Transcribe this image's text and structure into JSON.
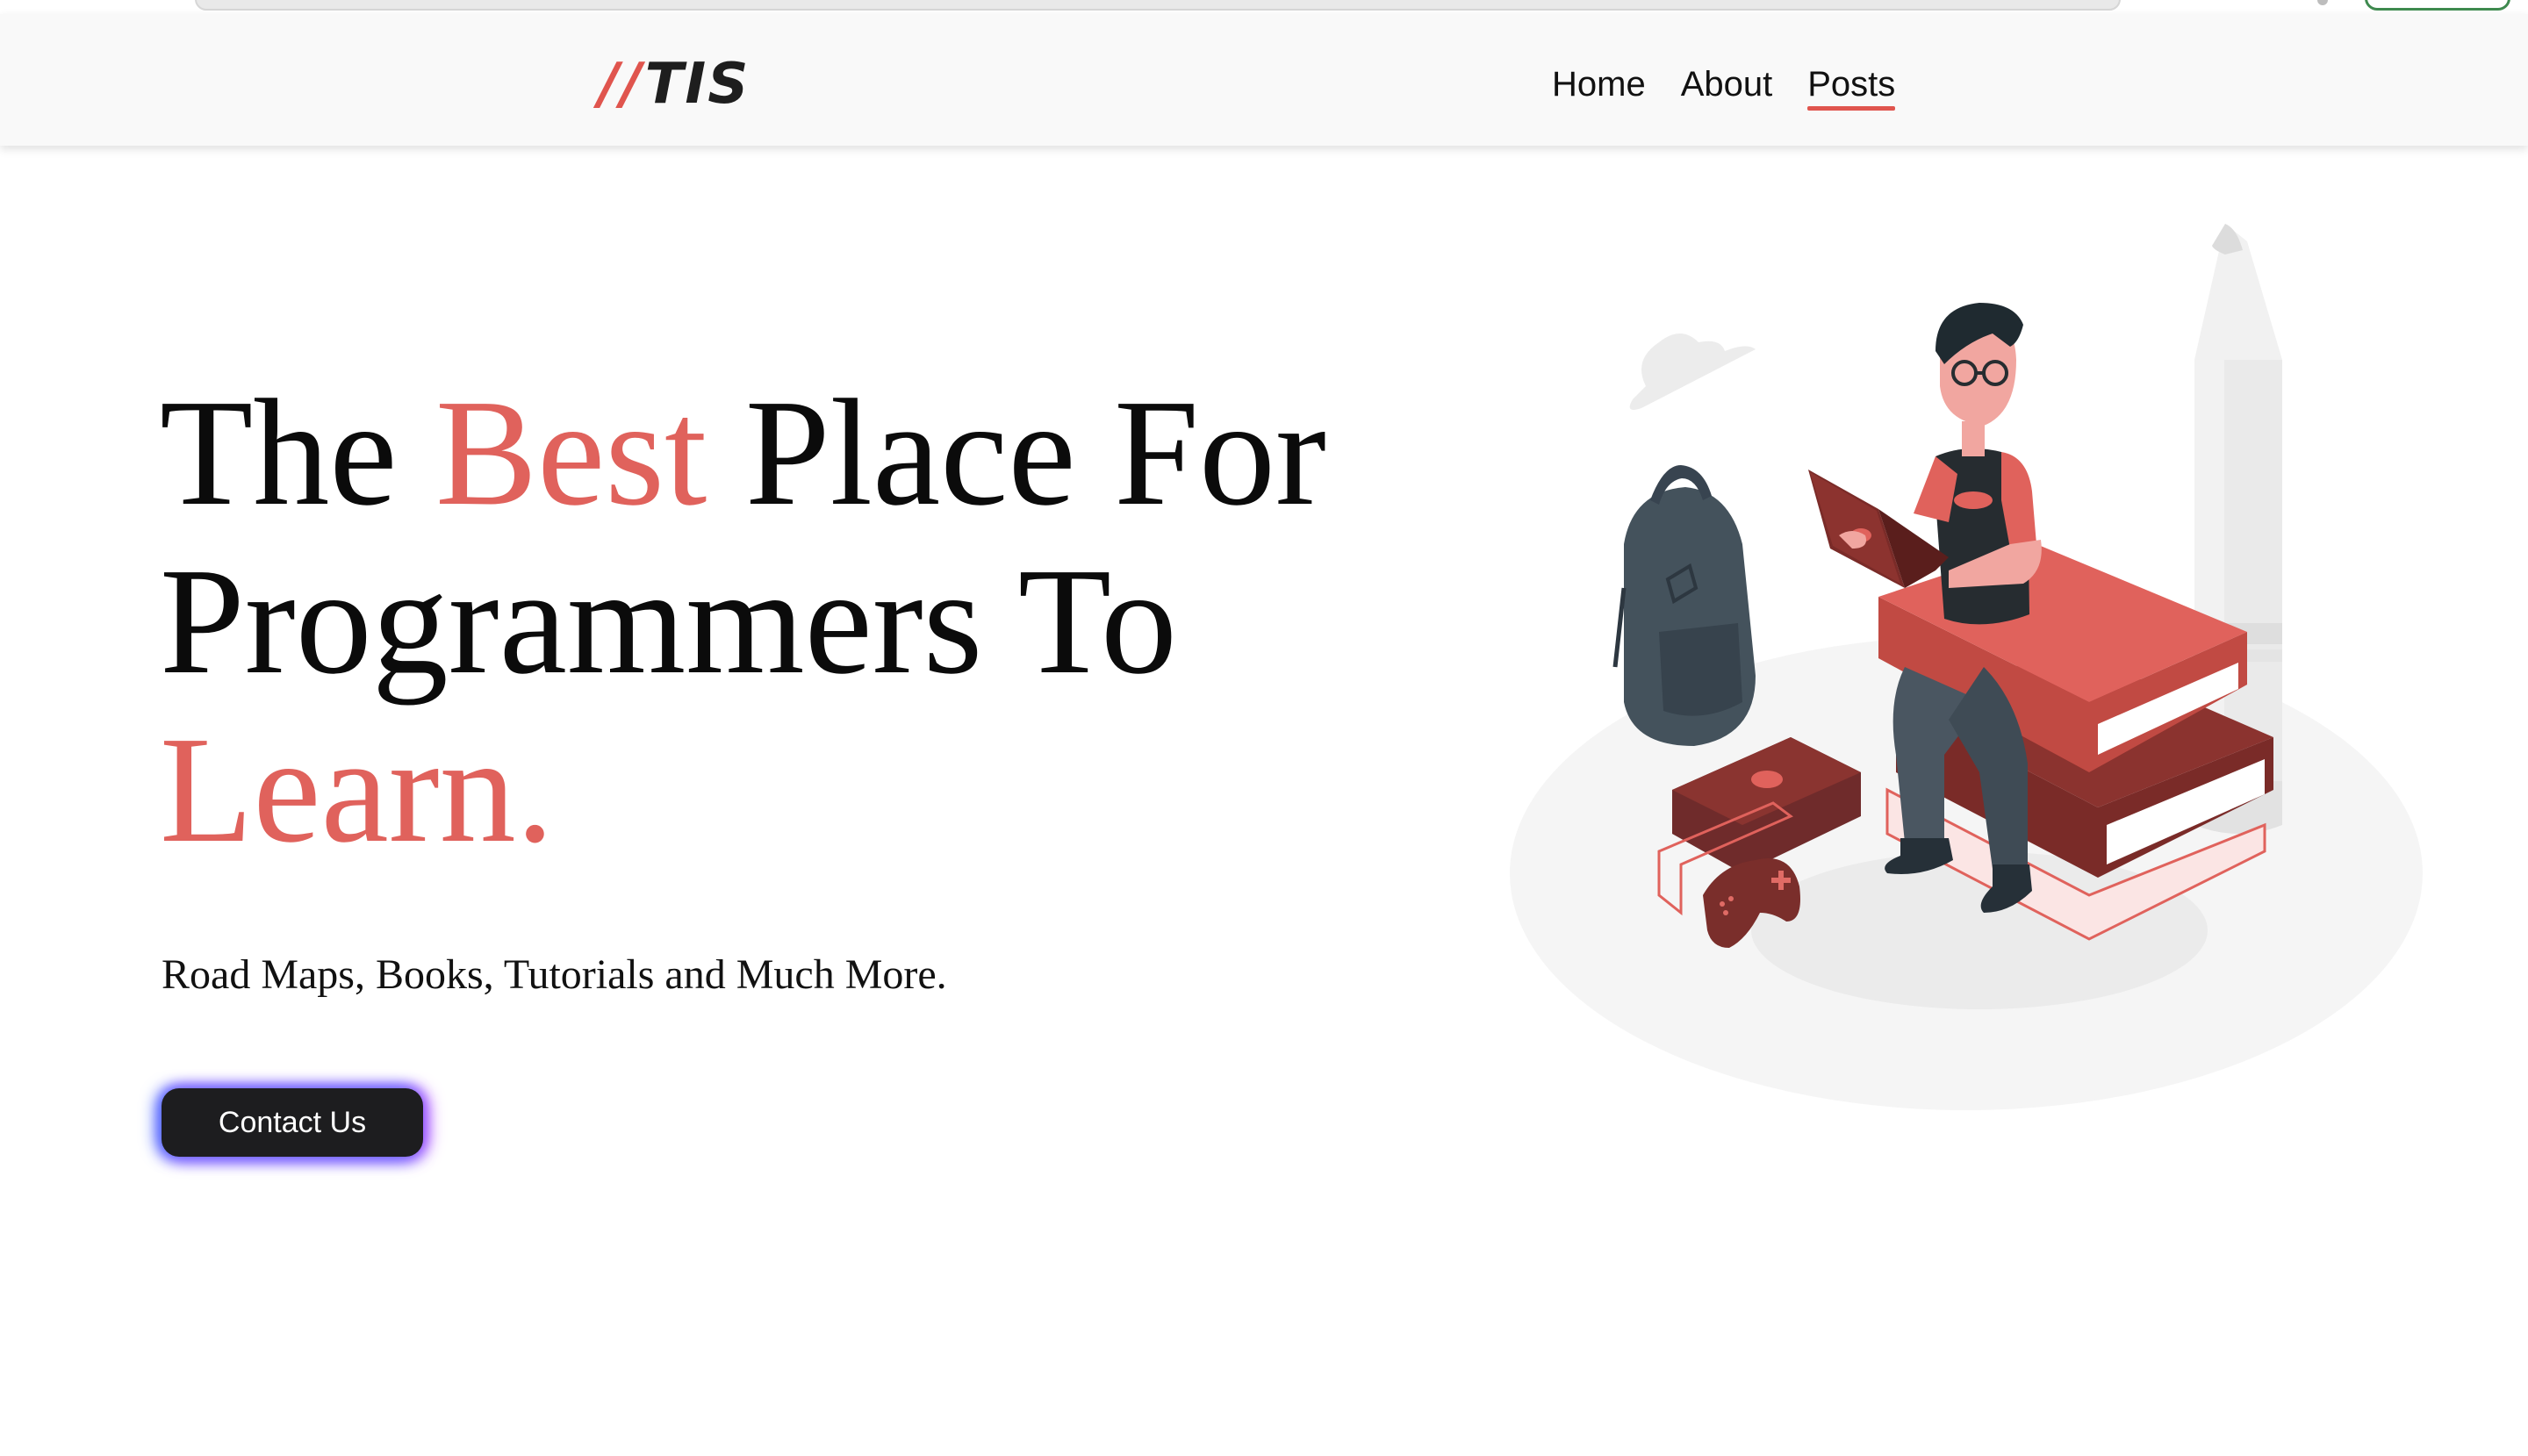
{
  "nav": {
    "logo_slashes": "//",
    "logo_text": "TIS",
    "links": [
      {
        "label": "Home",
        "active": false
      },
      {
        "label": "About",
        "active": false
      },
      {
        "label": "Posts",
        "active": true
      }
    ]
  },
  "hero": {
    "title_part1": "The ",
    "title_accent1": "Best",
    "title_part2": " Place For Programmers To ",
    "title_accent2": "Learn.",
    "subtitle": "Road Maps, Books, Tutorials and Much More.",
    "cta_label": "Contact Us"
  },
  "colors": {
    "accent": "#e0625c",
    "dark": "#1d1d1f",
    "navbar_bg": "#f9f9f9"
  },
  "icons": {
    "illustration": "programmer-on-books-illustration"
  }
}
